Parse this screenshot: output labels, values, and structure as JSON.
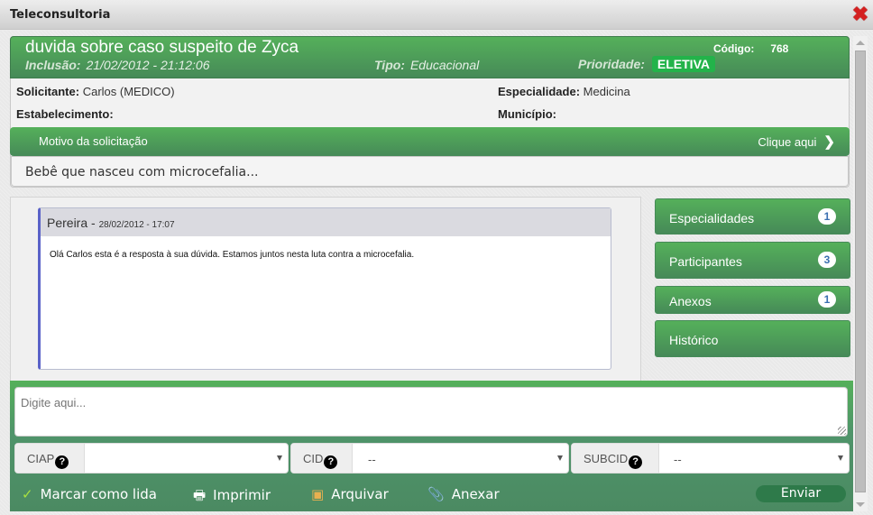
{
  "window": {
    "title": "Teleconsultoria",
    "close_icon": "close-x-icon"
  },
  "header": {
    "subject": "duvida sobre caso suspeito de Zyca",
    "codigo_label": "Código:",
    "codigo_value": "768",
    "inclusao_label": "Inclusão:",
    "inclusao_value": "21/02/2012 - 21:12:06",
    "tipo_label": "Tipo:",
    "tipo_value": "Educacional",
    "prioridade_label": "Prioridade:",
    "prioridade_value": "ELETIVA"
  },
  "info": {
    "solicitante_label": "Solicitante:",
    "solicitante_value": "Carlos  (MEDICO)",
    "especialidade_label": "Especialidade:",
    "especialidade_value": "Medicina",
    "estabelecimento_label": "Estabelecimento:",
    "estabelecimento_value": "",
    "municipio_label": "Município:",
    "municipio_value": ""
  },
  "motivo": {
    "label": "Motivo da solicitação",
    "action": "Clique aqui",
    "text": "Bebê que nasceu com microcefalia..."
  },
  "messages": [
    {
      "author": "Pereira",
      "separator": " - ",
      "datetime": "28/02/2012 - 17:07",
      "body": "Olá Carlos esta é a resposta à sua dúvida. Estamos juntos nesta luta contra a microcefalia."
    }
  ],
  "sidebar": {
    "items": [
      {
        "label": "Especialidades",
        "count": "1"
      },
      {
        "label": "Participantes",
        "count": "3"
      },
      {
        "label": "Anexos",
        "count": "1"
      },
      {
        "label": "Histórico"
      }
    ]
  },
  "composer": {
    "placeholder": "Digite aqui...",
    "ciap_label": "CIAP",
    "ciap_value": "",
    "cid_label": "CID",
    "cid_value": "--",
    "subcid_label": "SUBCID",
    "subcid_value": "--",
    "help_glyph": "?"
  },
  "actions": {
    "marcar": "Marcar como lida",
    "imprimir": "Imprimir",
    "arquivar": "Arquivar",
    "anexar": "Anexar",
    "enviar": "Enviar"
  },
  "colors": {
    "accent_green": "#55b05a",
    "badge_green": "#23b34a",
    "message_border": "#5a62c8",
    "close_red": "#d42020"
  }
}
